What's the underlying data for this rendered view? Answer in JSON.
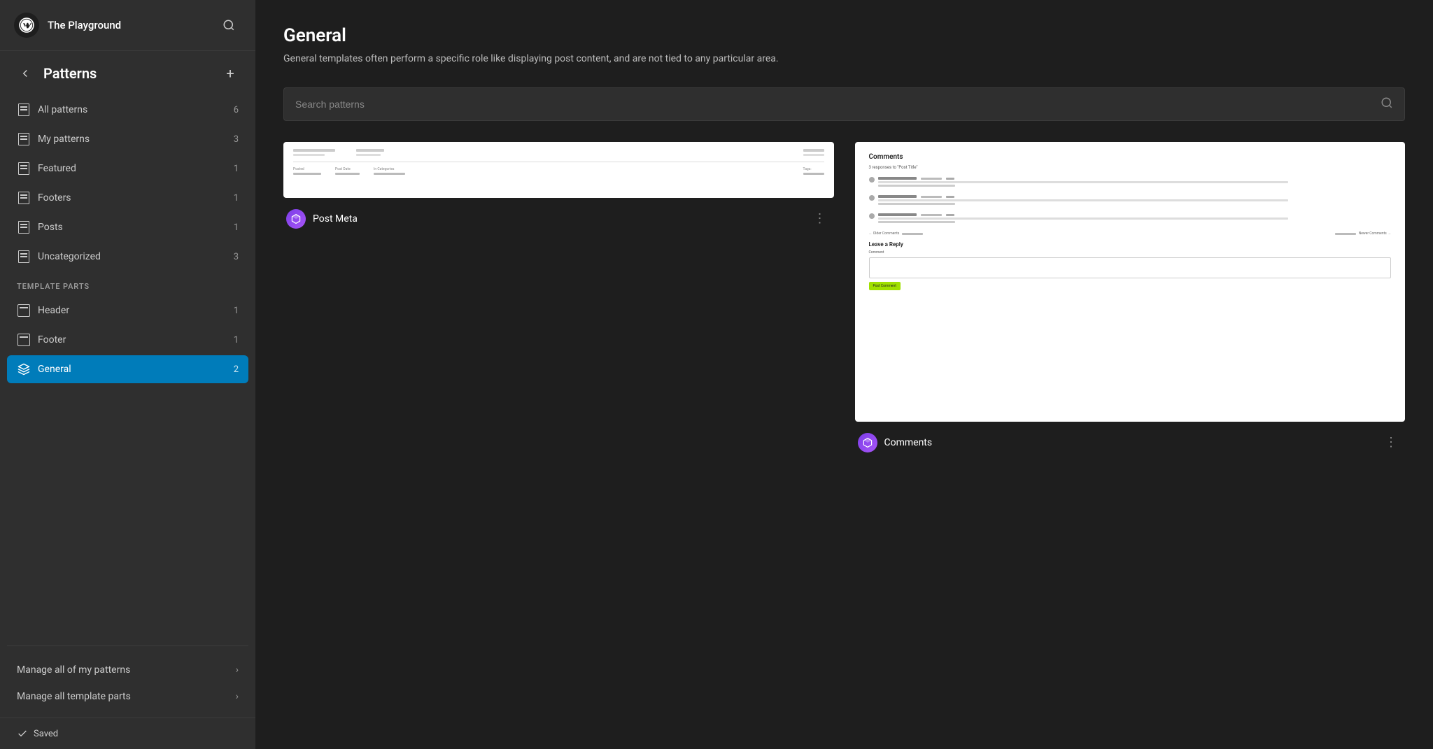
{
  "app": {
    "site_name": "The Playground"
  },
  "sidebar": {
    "title": "Patterns",
    "nav_items": [
      {
        "id": "all-patterns",
        "label": "All patterns",
        "count": 6,
        "active": false
      },
      {
        "id": "my-patterns",
        "label": "My patterns",
        "count": 3,
        "active": false
      },
      {
        "id": "featured",
        "label": "Featured",
        "count": 1,
        "active": false
      },
      {
        "id": "footers",
        "label": "Footers",
        "count": 1,
        "active": false
      },
      {
        "id": "posts",
        "label": "Posts",
        "count": 1,
        "active": false
      },
      {
        "id": "uncategorized",
        "label": "Uncategorized",
        "count": 3,
        "active": false
      }
    ],
    "template_parts_label": "TEMPLATE PARTS",
    "template_parts": [
      {
        "id": "header",
        "label": "Header",
        "count": 1,
        "active": false
      },
      {
        "id": "footer",
        "label": "Footer",
        "count": 1,
        "active": false
      },
      {
        "id": "general",
        "label": "General",
        "count": 2,
        "active": true
      }
    ],
    "manage_links": [
      {
        "id": "manage-patterns",
        "label": "Manage all of my patterns"
      },
      {
        "id": "manage-template-parts",
        "label": "Manage all template parts"
      }
    ],
    "saved_status": "Saved"
  },
  "main": {
    "title": "General",
    "description": "General templates often perform a specific role like displaying post content, and are not tied to any particular area.",
    "search_placeholder": "Search patterns",
    "patterns": [
      {
        "id": "post-meta",
        "name": "Post Meta",
        "type": "post-meta"
      },
      {
        "id": "comments",
        "name": "Comments",
        "type": "comments"
      }
    ]
  }
}
